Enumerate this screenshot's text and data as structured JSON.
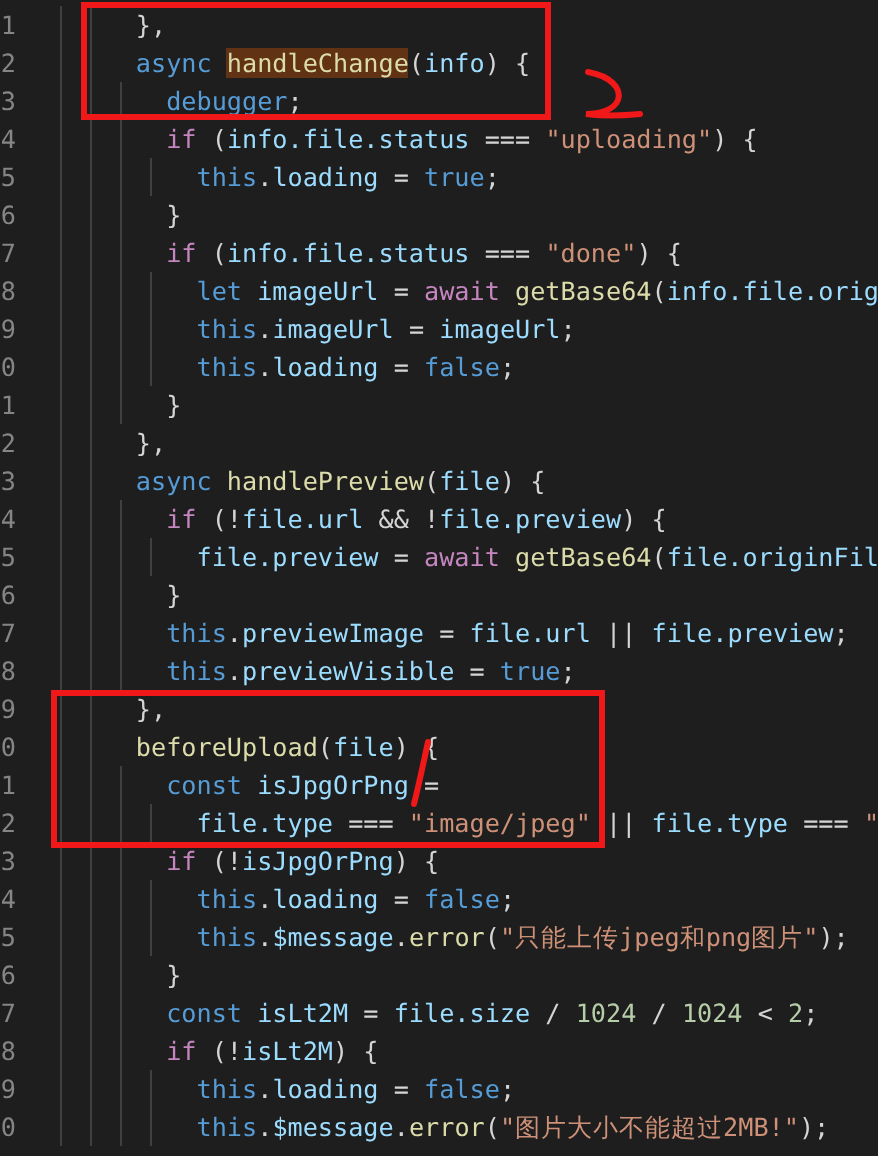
{
  "editor": {
    "lines": [
      {
        "number": "1",
        "tokens": [
          {
            "kind": "plain",
            "text": "    },"
          }
        ]
      },
      {
        "number": "2",
        "tokens": [
          {
            "kind": "keyword",
            "text": "    async "
          },
          {
            "kind": "function-match",
            "text": "handleChange"
          },
          {
            "kind": "plain",
            "text": "("
          },
          {
            "kind": "variable",
            "text": "info"
          },
          {
            "kind": "plain",
            "text": ") {"
          }
        ]
      },
      {
        "number": "3",
        "tokens": [
          {
            "kind": "keyword",
            "text": "      debugger"
          },
          {
            "kind": "plain",
            "text": ";"
          }
        ]
      },
      {
        "number": "4",
        "tokens": [
          {
            "kind": "control",
            "text": "      if"
          },
          {
            "kind": "plain",
            "text": " ("
          },
          {
            "kind": "variable",
            "text": "info.file.status"
          },
          {
            "kind": "plain",
            "text": " === "
          },
          {
            "kind": "string",
            "text": "\"uploading\""
          },
          {
            "kind": "plain",
            "text": ") {"
          }
        ]
      },
      {
        "number": "5",
        "tokens": [
          {
            "kind": "keyword",
            "text": "        this"
          },
          {
            "kind": "plain",
            "text": "."
          },
          {
            "kind": "variable",
            "text": "loading"
          },
          {
            "kind": "plain",
            "text": " = "
          },
          {
            "kind": "keyword",
            "text": "true"
          },
          {
            "kind": "plain",
            "text": ";"
          }
        ]
      },
      {
        "number": "6",
        "tokens": [
          {
            "kind": "plain",
            "text": "      }"
          }
        ]
      },
      {
        "number": "7",
        "tokens": [
          {
            "kind": "control",
            "text": "      if"
          },
          {
            "kind": "plain",
            "text": " ("
          },
          {
            "kind": "variable",
            "text": "info.file.status"
          },
          {
            "kind": "plain",
            "text": " === "
          },
          {
            "kind": "string",
            "text": "\"done\""
          },
          {
            "kind": "plain",
            "text": ") {"
          }
        ]
      },
      {
        "number": "8",
        "tokens": [
          {
            "kind": "keyword",
            "text": "        let "
          },
          {
            "kind": "variable",
            "text": "imageUrl"
          },
          {
            "kind": "plain",
            "text": " = "
          },
          {
            "kind": "control",
            "text": "await "
          },
          {
            "kind": "function",
            "text": "getBase64"
          },
          {
            "kind": "plain",
            "text": "("
          },
          {
            "kind": "variable",
            "text": "info.file.orig"
          }
        ]
      },
      {
        "number": "9",
        "tokens": [
          {
            "kind": "keyword",
            "text": "        this"
          },
          {
            "kind": "plain",
            "text": "."
          },
          {
            "kind": "variable",
            "text": "imageUrl"
          },
          {
            "kind": "plain",
            "text": " = "
          },
          {
            "kind": "variable",
            "text": "imageUrl"
          },
          {
            "kind": "plain",
            "text": ";"
          }
        ]
      },
      {
        "number": "0",
        "tokens": [
          {
            "kind": "keyword",
            "text": "        this"
          },
          {
            "kind": "plain",
            "text": "."
          },
          {
            "kind": "variable",
            "text": "loading"
          },
          {
            "kind": "plain",
            "text": " = "
          },
          {
            "kind": "keyword",
            "text": "false"
          },
          {
            "kind": "plain",
            "text": ";"
          }
        ]
      },
      {
        "number": "1",
        "tokens": [
          {
            "kind": "plain",
            "text": "      }"
          }
        ]
      },
      {
        "number": "2",
        "tokens": [
          {
            "kind": "plain",
            "text": "    },"
          }
        ]
      },
      {
        "number": "3",
        "tokens": [
          {
            "kind": "keyword",
            "text": "    async "
          },
          {
            "kind": "function",
            "text": "handlePreview"
          },
          {
            "kind": "plain",
            "text": "("
          },
          {
            "kind": "variable",
            "text": "file"
          },
          {
            "kind": "plain",
            "text": ") {"
          }
        ]
      },
      {
        "number": "4",
        "tokens": [
          {
            "kind": "control",
            "text": "      if"
          },
          {
            "kind": "plain",
            "text": " (!"
          },
          {
            "kind": "variable",
            "text": "file.url"
          },
          {
            "kind": "plain",
            "text": " && !"
          },
          {
            "kind": "variable",
            "text": "file.preview"
          },
          {
            "kind": "plain",
            "text": ") {"
          }
        ]
      },
      {
        "number": "5",
        "tokens": [
          {
            "kind": "variable",
            "text": "        file.preview"
          },
          {
            "kind": "plain",
            "text": " = "
          },
          {
            "kind": "control",
            "text": "await "
          },
          {
            "kind": "function",
            "text": "getBase64"
          },
          {
            "kind": "plain",
            "text": "("
          },
          {
            "kind": "variable",
            "text": "file.originFil"
          }
        ]
      },
      {
        "number": "6",
        "tokens": [
          {
            "kind": "plain",
            "text": "      }"
          }
        ]
      },
      {
        "number": "7",
        "tokens": [
          {
            "kind": "keyword",
            "text": "      this"
          },
          {
            "kind": "plain",
            "text": "."
          },
          {
            "kind": "variable",
            "text": "previewImage"
          },
          {
            "kind": "plain",
            "text": " = "
          },
          {
            "kind": "variable",
            "text": "file.url"
          },
          {
            "kind": "plain",
            "text": " || "
          },
          {
            "kind": "variable",
            "text": "file.preview"
          },
          {
            "kind": "plain",
            "text": ";"
          }
        ]
      },
      {
        "number": "8",
        "tokens": [
          {
            "kind": "keyword",
            "text": "      this"
          },
          {
            "kind": "plain",
            "text": "."
          },
          {
            "kind": "variable",
            "text": "previewVisible"
          },
          {
            "kind": "plain",
            "text": " = "
          },
          {
            "kind": "keyword",
            "text": "true"
          },
          {
            "kind": "plain",
            "text": ";"
          }
        ]
      },
      {
        "number": "9",
        "tokens": [
          {
            "kind": "plain",
            "text": "    },"
          }
        ]
      },
      {
        "number": "0",
        "tokens": [
          {
            "kind": "function",
            "text": "    beforeUpload"
          },
          {
            "kind": "plain",
            "text": "("
          },
          {
            "kind": "variable",
            "text": "file"
          },
          {
            "kind": "plain",
            "text": ") {"
          }
        ]
      },
      {
        "number": "1",
        "tokens": [
          {
            "kind": "keyword",
            "text": "      const "
          },
          {
            "kind": "variable",
            "text": "isJpgOrPng"
          },
          {
            "kind": "plain",
            "text": " ="
          }
        ]
      },
      {
        "number": "2",
        "tokens": [
          {
            "kind": "variable",
            "text": "        file.type"
          },
          {
            "kind": "plain",
            "text": " === "
          },
          {
            "kind": "string",
            "text": "\"image/jpeg\""
          },
          {
            "kind": "plain",
            "text": " || "
          },
          {
            "kind": "variable",
            "text": "file.type"
          },
          {
            "kind": "plain",
            "text": " === "
          },
          {
            "kind": "string",
            "text": "\""
          }
        ]
      },
      {
        "number": "3",
        "tokens": [
          {
            "kind": "control",
            "text": "      if"
          },
          {
            "kind": "plain",
            "text": " (!"
          },
          {
            "kind": "variable",
            "text": "isJpgOrPng"
          },
          {
            "kind": "plain",
            "text": ") {"
          }
        ]
      },
      {
        "number": "4",
        "tokens": [
          {
            "kind": "keyword",
            "text": "        this"
          },
          {
            "kind": "plain",
            "text": "."
          },
          {
            "kind": "variable",
            "text": "loading"
          },
          {
            "kind": "plain",
            "text": " = "
          },
          {
            "kind": "keyword",
            "text": "false"
          },
          {
            "kind": "plain",
            "text": ";"
          }
        ]
      },
      {
        "number": "5",
        "tokens": [
          {
            "kind": "keyword",
            "text": "        this"
          },
          {
            "kind": "plain",
            "text": "."
          },
          {
            "kind": "variable",
            "text": "$message"
          },
          {
            "kind": "plain",
            "text": "."
          },
          {
            "kind": "function",
            "text": "error"
          },
          {
            "kind": "plain",
            "text": "("
          },
          {
            "kind": "string",
            "text": "\"只能上传jpeg和png图片\""
          },
          {
            "kind": "plain",
            "text": ");"
          }
        ]
      },
      {
        "number": "6",
        "tokens": [
          {
            "kind": "plain",
            "text": "      }"
          }
        ]
      },
      {
        "number": "7",
        "tokens": [
          {
            "kind": "keyword",
            "text": "      const "
          },
          {
            "kind": "variable",
            "text": "isLt2M"
          },
          {
            "kind": "plain",
            "text": " = "
          },
          {
            "kind": "variable",
            "text": "file.size"
          },
          {
            "kind": "plain",
            "text": " / "
          },
          {
            "kind": "number",
            "text": "1024"
          },
          {
            "kind": "plain",
            "text": " / "
          },
          {
            "kind": "number",
            "text": "1024"
          },
          {
            "kind": "plain",
            "text": " < "
          },
          {
            "kind": "number",
            "text": "2"
          },
          {
            "kind": "plain",
            "text": ";"
          }
        ]
      },
      {
        "number": "8",
        "tokens": [
          {
            "kind": "control",
            "text": "      if"
          },
          {
            "kind": "plain",
            "text": " (!"
          },
          {
            "kind": "variable",
            "text": "isLt2M"
          },
          {
            "kind": "plain",
            "text": ") {"
          }
        ]
      },
      {
        "number": "9",
        "tokens": [
          {
            "kind": "keyword",
            "text": "        this"
          },
          {
            "kind": "plain",
            "text": "."
          },
          {
            "kind": "variable",
            "text": "loading"
          },
          {
            "kind": "plain",
            "text": " = "
          },
          {
            "kind": "keyword",
            "text": "false"
          },
          {
            "kind": "plain",
            "text": ";"
          }
        ]
      },
      {
        "number": "0",
        "tokens": [
          {
            "kind": "keyword",
            "text": "        this"
          },
          {
            "kind": "plain",
            "text": "."
          },
          {
            "kind": "variable",
            "text": "$message"
          },
          {
            "kind": "plain",
            "text": "."
          },
          {
            "kind": "function",
            "text": "error"
          },
          {
            "kind": "plain",
            "text": "("
          },
          {
            "kind": "string",
            "text": "\"图片大小不能超过2MB!\""
          },
          {
            "kind": "plain",
            "text": ");"
          }
        ]
      }
    ]
  }
}
